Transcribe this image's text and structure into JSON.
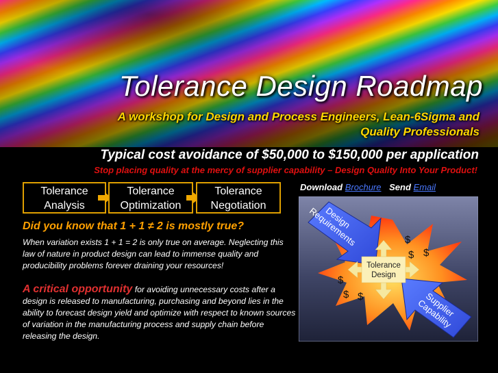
{
  "header": {
    "title": "Tolerance Design Roadmap",
    "subtitle_line1": "A workshop for Design and Process Engineers, Lean-6Sigma and",
    "subtitle_line2": "Quality Professionals",
    "cost_line": "Typical cost avoidance of $50,000 to $150,000 per application",
    "stop_line": "Stop placing quality at the mercy of supplier capability – Design Quality Into Your Product!"
  },
  "steps": [
    {
      "line1": "Tolerance",
      "line2": "Analysis"
    },
    {
      "line1": "Tolerance",
      "line2": "Optimization"
    },
    {
      "line1": "Tolerance",
      "line2": "Negotiation"
    }
  ],
  "body": {
    "question": "Did you know that 1 + 1 ≠ 2 is mostly true?",
    "para1": "When variation exists 1 + 1 = 2 is only true on average. Neglecting this law of nature in product design can lead to immense quality and producibility problems forever draining your resources!",
    "para2_highlight": "A critical opportunity",
    "para2_rest": " for avoiding unnecessary costs after a design is released to manufacturing, purchasing and beyond lies in the ability to forecast design yield and optimize with respect to known sources of variation in the manufacturing process and supply chain before releasing the design."
  },
  "links": {
    "download_label": "Download",
    "brochure_link": "Brochure",
    "send_label": "Send",
    "email_link": "Email"
  },
  "diagram": {
    "arrow1_line1": "Design",
    "arrow1_line2": "Requirements",
    "arrow2_line1": "Supplier",
    "arrow2_line2": "Capability",
    "center_line1": "Tolerance",
    "center_line2": "Design",
    "dollar": "$"
  },
  "colors": {
    "accent_orange": "#e0a000",
    "question_orange": "#ffa000",
    "link_blue": "#4a78ff",
    "stop_red": "#e01010",
    "subtitle_gold": "#ffd700"
  }
}
